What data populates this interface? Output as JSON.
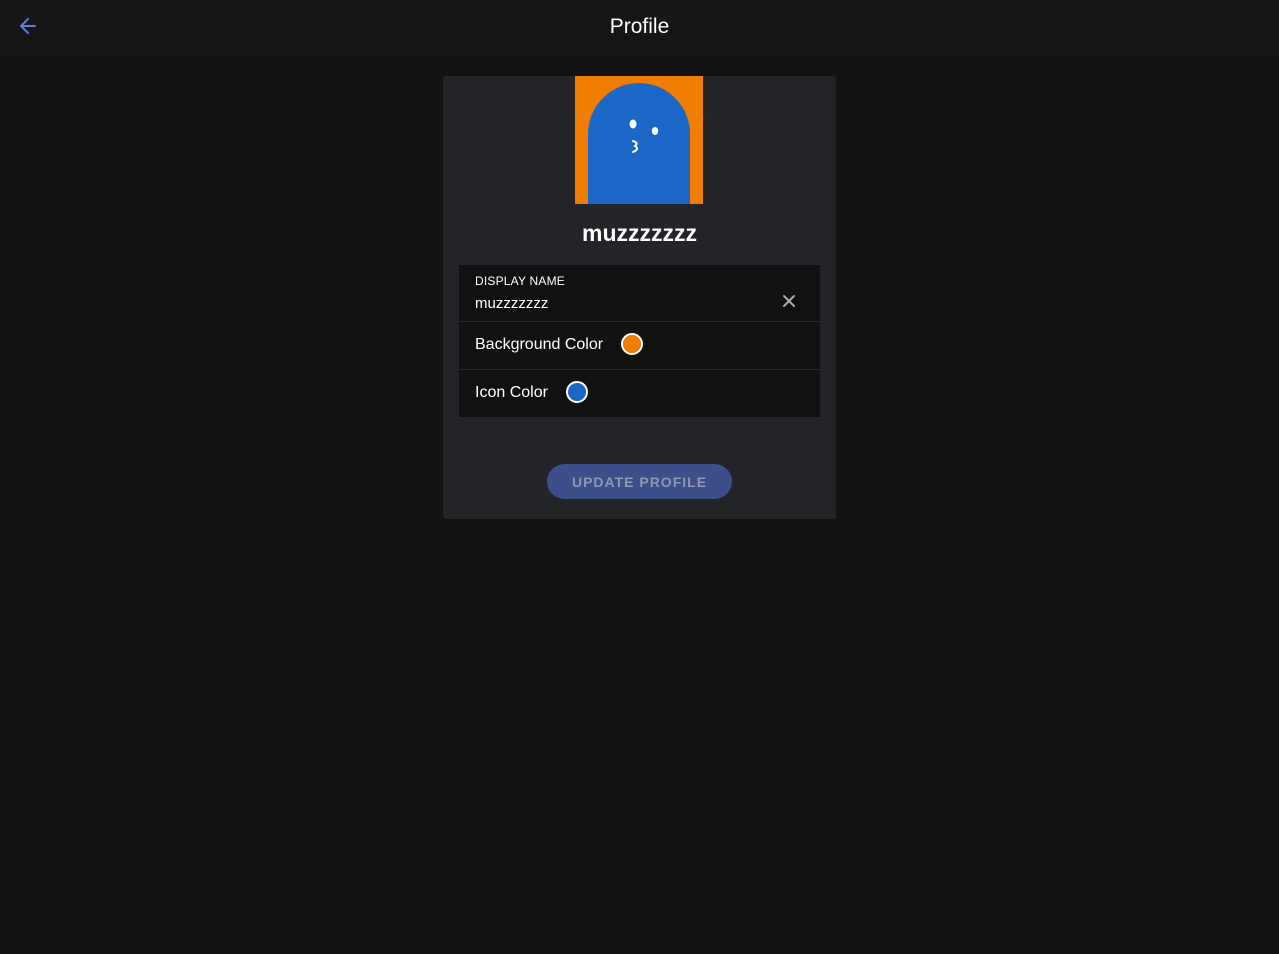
{
  "header": {
    "title": "Profile",
    "back_icon": "arrow-left-icon",
    "accent_color": "#5a7bdc"
  },
  "profile": {
    "username": "muzzzzzzz",
    "avatar": {
      "background_color": "#f07c00",
      "icon_color": "#1a67c7",
      "icon": "ghost-icon"
    }
  },
  "form": {
    "display_name": {
      "label": "DISPLAY NAME",
      "value": "muzzzzzzz",
      "clear_icon": "close-icon"
    },
    "background_color": {
      "label": "Background Color",
      "value": "#f07c00"
    },
    "icon_color": {
      "label": "Icon Color",
      "value": "#1a67c7"
    }
  },
  "actions": {
    "update_label": "UPDATE PROFILE",
    "update_enabled": false
  }
}
